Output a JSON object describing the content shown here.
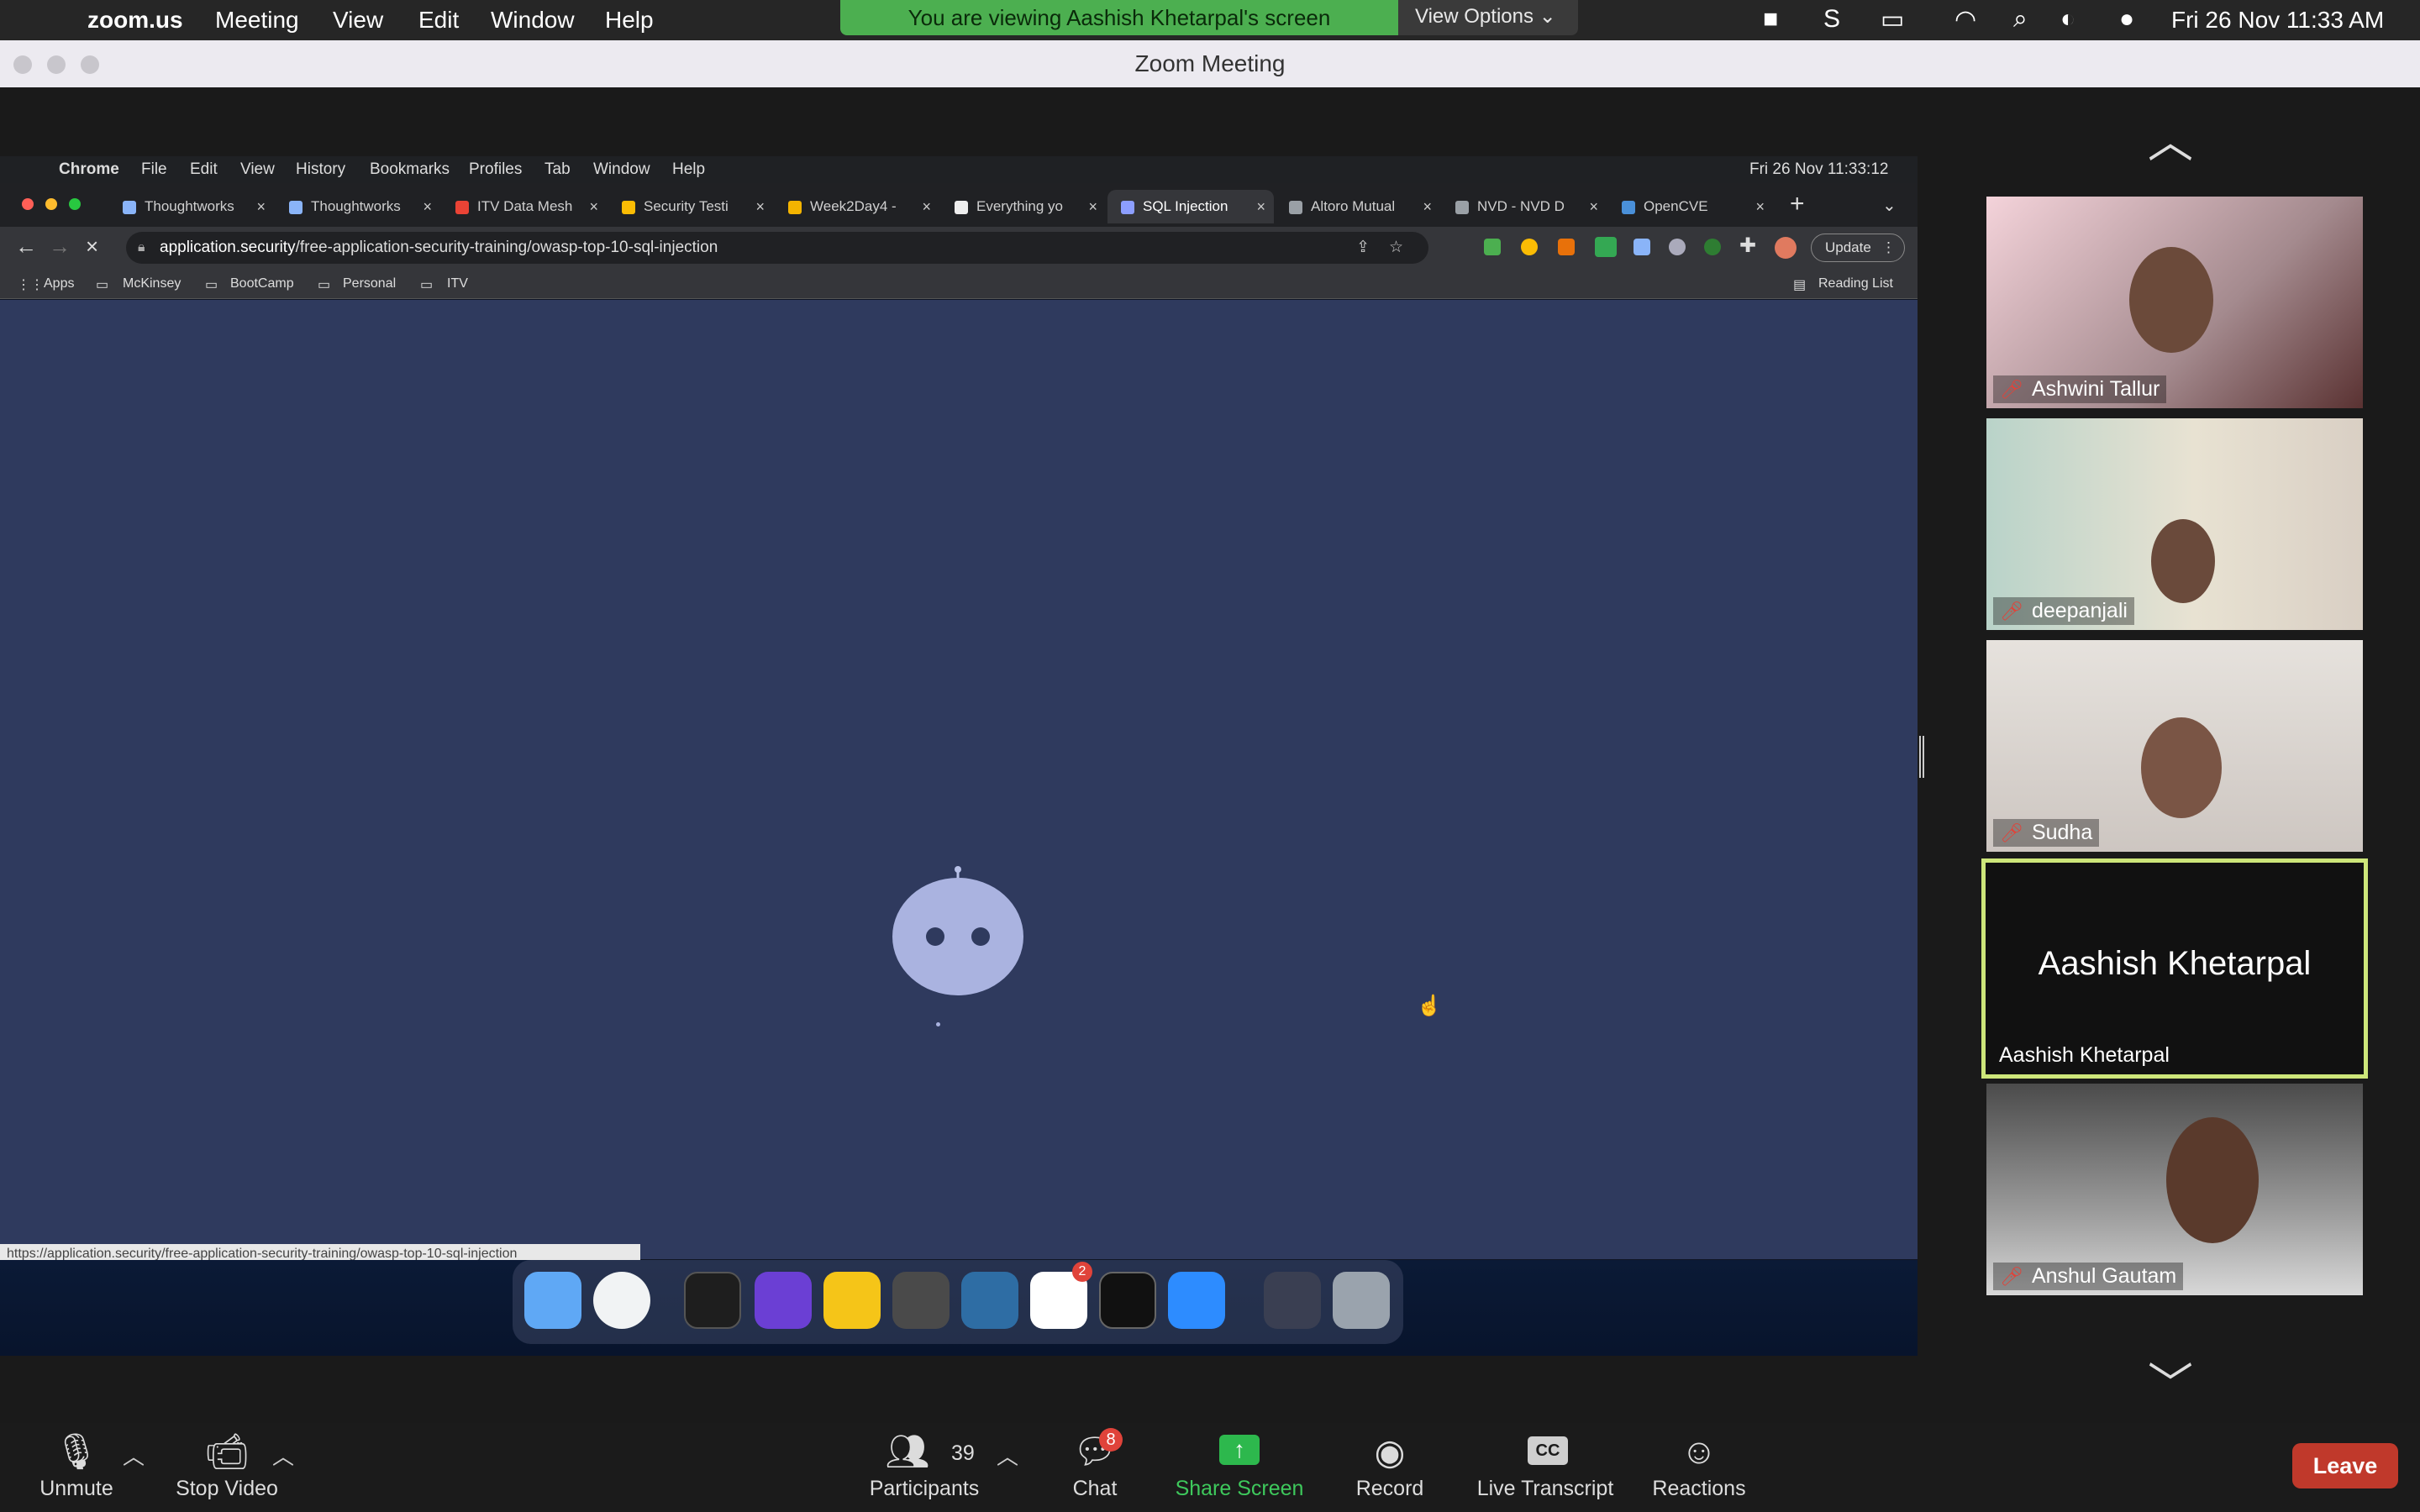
{
  "mac_menubar": {
    "app": "zoom.us",
    "items": [
      "Meeting",
      "View",
      "Edit",
      "Window",
      "Help"
    ],
    "datetime": "Fri 26 Nov  11:33 AM"
  },
  "share_banner": {
    "text": "You are viewing Aashish Khetarpal's screen",
    "view_options": "View Options ⌄"
  },
  "window": {
    "title": "Zoom Meeting"
  },
  "shared_screen": {
    "chrome_menu": {
      "app": "Chrome",
      "items": [
        "File",
        "Edit",
        "View",
        "History",
        "Bookmarks",
        "Profiles",
        "Tab",
        "Window",
        "Help"
      ],
      "datetime": "Fri 26 Nov  11:33:12"
    },
    "tabs": [
      {
        "title": "Thoughtworks"
      },
      {
        "title": "Thoughtworks"
      },
      {
        "title": "ITV Data Mesh"
      },
      {
        "title": "Security Testi"
      },
      {
        "title": "Week2Day4 -"
      },
      {
        "title": "Everything yo"
      },
      {
        "title": "SQL Injection"
      },
      {
        "title": "Altoro Mutual"
      },
      {
        "title": "NVD - NVD D"
      },
      {
        "title": "OpenCVE"
      }
    ],
    "url_host": "application.security",
    "url_path": "/free-application-security-training/owasp-top-10-sql-injection",
    "update_label": "Update",
    "bookmarks": [
      "Apps",
      "McKinsey",
      "BootCamp",
      "Personal",
      "ITV"
    ],
    "reading_list": "Reading List",
    "status_url": "https://application.security/free-application-security-training/owasp-top-10-sql-injection",
    "dock_badge": "2"
  },
  "participants": [
    {
      "name": "Ashwini Tallur"
    },
    {
      "name": "deepanjali"
    },
    {
      "name": "Sudha"
    },
    {
      "name": "Aashish Khetarpal",
      "display": "Aashish Khetarpal"
    },
    {
      "name": "Anshul Gautam"
    }
  ],
  "toolbar": {
    "unmute": "Unmute",
    "stop_video": "Stop Video",
    "participants": "Participants",
    "participant_count": "39",
    "chat": "Chat",
    "chat_badge": "8",
    "share_screen": "Share Screen",
    "record": "Record",
    "live_transcript": "Live Transcript",
    "reactions": "Reactions",
    "leave": "Leave"
  },
  "colors": {
    "share_green": "#4caf50",
    "leave_red": "#c0392b",
    "active_speaker_border": "#cde67a"
  }
}
